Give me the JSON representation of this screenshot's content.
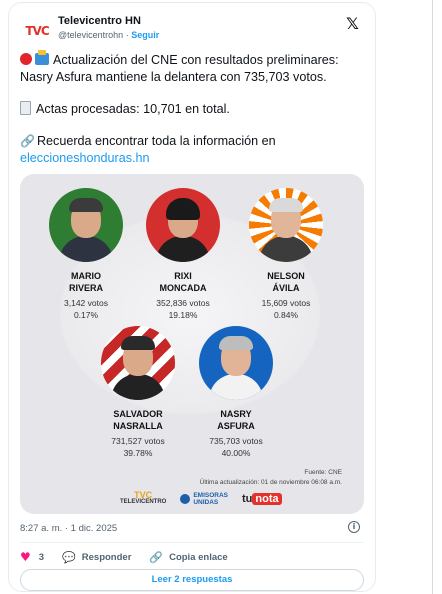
{
  "account": {
    "name": "Televicentro HN",
    "handle": "@televicentrohn",
    "separator": "·",
    "follow_label": "Seguir",
    "avatar_text": "TVC"
  },
  "tweet": {
    "line1": "Actualización del CNE con resultados preliminares: Nasry Asfura mantiene la delantera con 735,703 votos.",
    "line2": "Actas procesadas: 10,701 en total.",
    "line3": "Recuerda encontrar toda la información en",
    "link": "eleccioneshonduras.hn"
  },
  "graphic": {
    "candidates": [
      {
        "name": "MARIO\nRIVERA",
        "votes": "3,142 votos",
        "pct": "0.17%",
        "color": "#2e7d32"
      },
      {
        "name": "RIXI\nMONCADA",
        "votes": "352,836 votos",
        "pct": "19.18%",
        "color": "#d32f2f"
      },
      {
        "name": "NELSON\nÁVILA",
        "votes": "15,609 votos",
        "pct": "0.84%",
        "color": "#f57c00"
      },
      {
        "name": "SALVADOR\nNASRALLA",
        "votes": "731,527 votos",
        "pct": "39.78%",
        "color": "#c62828"
      },
      {
        "name": "NASRY\nASFURA",
        "votes": "735,703 votos",
        "pct": "40.00%",
        "color": "#1565c0"
      }
    ],
    "source": "Fuente: CNE",
    "updated": "Última actualización: 01 de noviembre 06:08 a.m.",
    "logo_tvc_big": "TVC",
    "logo_tvc_small": "TELEVICENTRO",
    "logo_em_line1": "EMISORAS",
    "logo_em_line2": "UNIDAS",
    "logo_tu": "tu",
    "logo_nota": "nota"
  },
  "meta": {
    "timestamp": "8:27 a. m. · 1 dic. 2025",
    "likes": "3",
    "reply_label": "Responder",
    "copy_label": "Copia enlace",
    "replies_button": "Leer 2 respuestas"
  },
  "icons": [
    "x-logo-icon",
    "info-icon",
    "heart-icon",
    "reply-icon",
    "link-icon"
  ]
}
